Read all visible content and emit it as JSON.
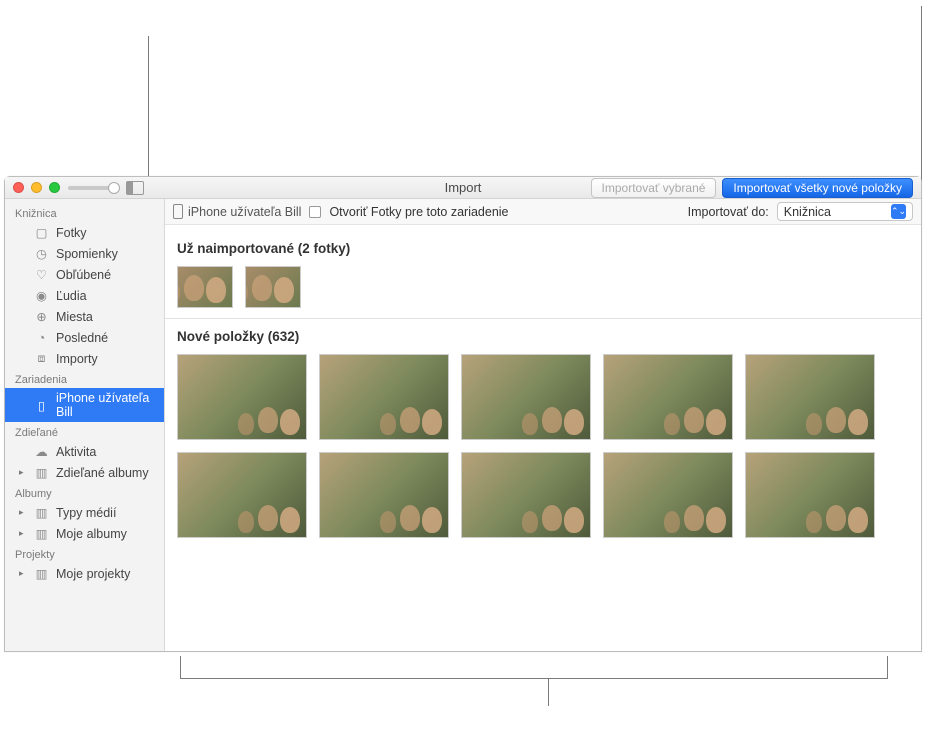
{
  "windowTitle": "Import",
  "buttons": {
    "importSelected": "Importovať vybrané",
    "importAllNew": "Importovať všetky nové položky"
  },
  "toolbar": {
    "deviceName": "iPhone užívateľa Bill",
    "openPhotosLabel": "Otvoriť Fotky pre toto zariadenie",
    "importToLabel": "Importovať do:",
    "importToValue": "Knižnica"
  },
  "sections": {
    "alreadyImported": {
      "titlePrefix": "Už naimportované",
      "count": 2,
      "countUnit": "fotky"
    },
    "newItems": {
      "titlePrefix": "Nové položky",
      "count": 632
    }
  },
  "sidebar": {
    "groups": [
      {
        "header": "Knižnica",
        "items": [
          {
            "label": "Fotky",
            "icon": "photos"
          },
          {
            "label": "Spomienky",
            "icon": "clock"
          },
          {
            "label": "Obľúbené",
            "icon": "heart"
          },
          {
            "label": "Ľudia",
            "icon": "person"
          },
          {
            "label": "Miesta",
            "icon": "pin"
          },
          {
            "label": "Posledné",
            "icon": "clock2"
          },
          {
            "label": "Importy",
            "icon": "download"
          }
        ]
      },
      {
        "header": "Zariadenia",
        "items": [
          {
            "label": "iPhone užívateľa Bill",
            "icon": "phone",
            "selected": true
          }
        ]
      },
      {
        "header": "Zdieľané",
        "items": [
          {
            "label": "Aktivita",
            "icon": "cloud"
          },
          {
            "label": "Zdieľané albumy",
            "icon": "album",
            "disclosure": true
          }
        ]
      },
      {
        "header": "Albumy",
        "items": [
          {
            "label": "Typy médií",
            "icon": "album",
            "disclosure": true
          },
          {
            "label": "Moje albumy",
            "icon": "album",
            "disclosure": true
          }
        ]
      },
      {
        "header": "Projekty",
        "items": [
          {
            "label": "Moje projekty",
            "icon": "album",
            "disclosure": true
          }
        ]
      }
    ]
  },
  "iconGlyphs": {
    "photos": "▢",
    "clock": "◷",
    "heart": "♡",
    "person": "◉",
    "pin": "⊕",
    "clock2": "◔",
    "download": "⧈",
    "phone": "▯",
    "cloud": "☁",
    "album": "▥"
  }
}
